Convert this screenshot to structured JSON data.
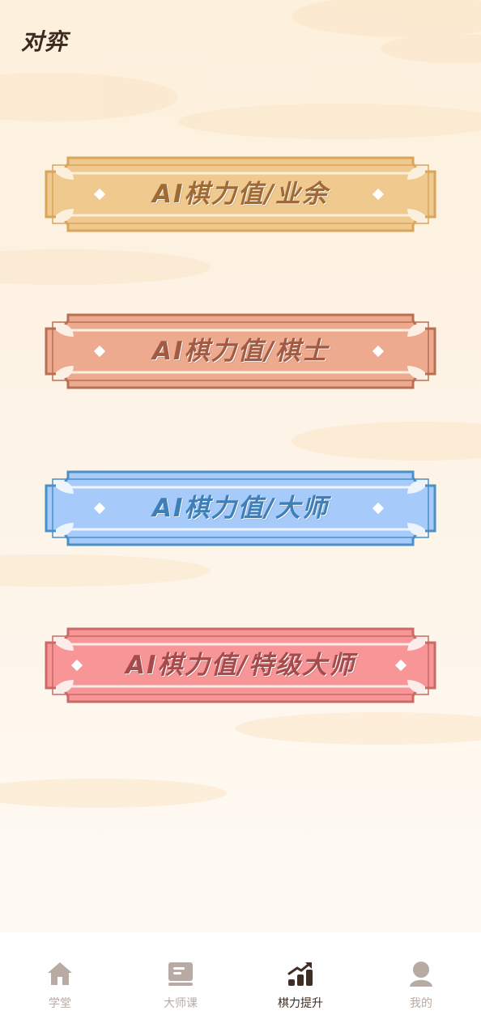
{
  "header": {
    "title": "对弈"
  },
  "levels": [
    {
      "label": "AI棋力值/业余",
      "fill": "#f0c98f",
      "border": "#d9a55b",
      "text": "#a06a35",
      "corner": "#fbf0de"
    },
    {
      "label": "AI棋力值/棋士",
      "fill": "#eeaa8e",
      "border": "#b87055",
      "text": "#a25a43",
      "corner": "#fcefe3"
    },
    {
      "label": "AI棋力值/大师",
      "fill": "#a6cbfa",
      "border": "#4a90c6",
      "text": "#3d7fb6",
      "corner": "#edf4fb"
    },
    {
      "label": "AI棋力值/特级大师",
      "fill": "#f79597",
      "border": "#c96a67",
      "text": "#a64b4c",
      "corner": "#fcecea"
    }
  ],
  "tabs": [
    {
      "label": "学堂",
      "icon": "home-icon",
      "active": false
    },
    {
      "label": "大师课",
      "icon": "book-icon",
      "active": false
    },
    {
      "label": "棋力提升",
      "icon": "chart-rise-icon",
      "active": true
    },
    {
      "label": "我的",
      "icon": "user-icon",
      "active": false
    }
  ],
  "colors": {
    "tab_inactive": "#b7aba3",
    "tab_active": "#3e2e25",
    "title": "#3b2a20"
  }
}
